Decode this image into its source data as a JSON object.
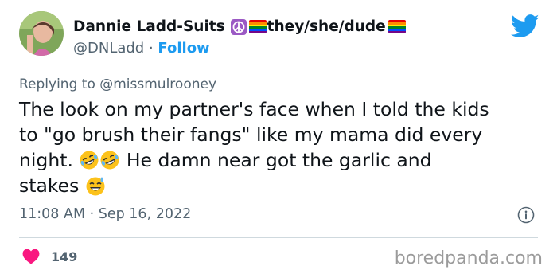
{
  "author": {
    "display_name": "Dannie Ladd-Suits",
    "pronouns": "they/she/dude",
    "handle": "@DNLadd",
    "separator": " · ",
    "follow_label": "Follow"
  },
  "reply": {
    "prefix": "Replying to ",
    "mention": "@missmulrooney"
  },
  "tweet": {
    "line1": "The look on my partner's face when I told the kids",
    "line2": "to \"go brush their fangs\" like my mama did every",
    "line3_a": "night. ",
    "line3_b": " He damn near got the garlic and",
    "line4": "stakes "
  },
  "meta": {
    "timestamp": "11:08 AM · Sep 16, 2022"
  },
  "engagement": {
    "likes": "149"
  },
  "watermark": "boredpanda.com",
  "colors": {
    "accent": "#1d9bf0",
    "heart": "#f91880",
    "muted": "#536471"
  },
  "icons": [
    "peace-icon",
    "rainbow-flag-icon",
    "twitter-bird-icon",
    "rofl-emoji",
    "sweat-smile-emoji",
    "info-icon",
    "heart-icon"
  ]
}
